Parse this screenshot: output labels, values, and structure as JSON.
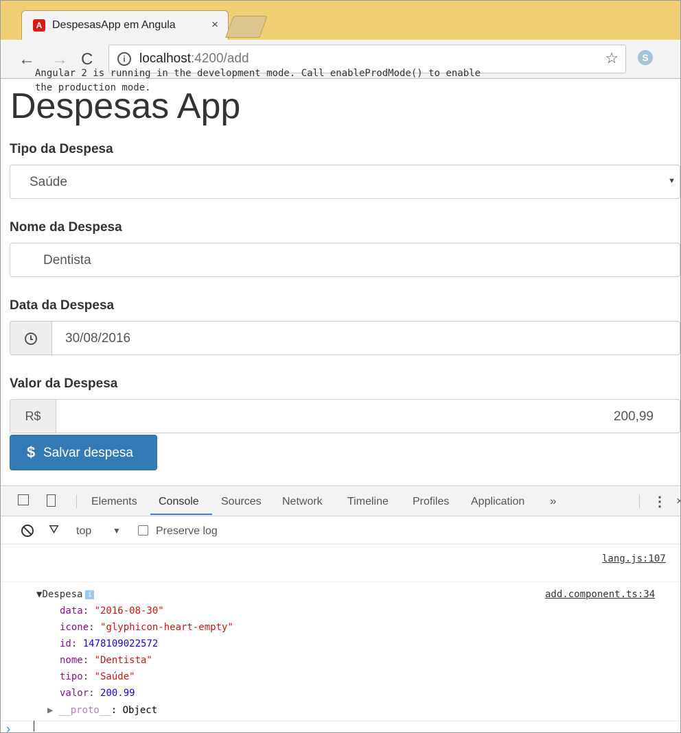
{
  "browser": {
    "tab_title": "DespesasApp em Angula",
    "tab_close": "×",
    "url_host": "localhost",
    "url_rest": ":4200/add",
    "star": "☆"
  },
  "page": {
    "title": "Despesas App",
    "tipo_label": "Tipo da Despesa",
    "tipo_value": "Saúde",
    "nome_label": "Nome da Despesa",
    "nome_value": "Dentista",
    "data_label": "Data da Despesa",
    "data_value": "30/08/2016",
    "valor_label": "Valor da Despesa",
    "currency": "R$",
    "valor_value": "200,99",
    "save_icon": "$",
    "save_label": "Salvar despesa"
  },
  "devtools": {
    "tabs": [
      "Elements",
      "Console",
      "Sources",
      "Network",
      "Timeline",
      "Profiles",
      "Application"
    ],
    "more": "»",
    "context": "top",
    "preserve_log": "Preserve log",
    "message1_line1": "Angular 2 is running in the development mode. Call enableProdMode() to enable",
    "message1_line2": "the production mode.",
    "message1_src": "lang.js:107",
    "object_name": "Despesa",
    "object_src": "add.component.ts:34",
    "props": [
      {
        "key": "data",
        "value": "\"2016-08-30\"",
        "kind": "string"
      },
      {
        "key": "icone",
        "value": "\"glyphicon-heart-empty\"",
        "kind": "string"
      },
      {
        "key": "id",
        "value": "1478109022572",
        "kind": "number"
      },
      {
        "key": "nome",
        "value": "\"Dentista\"",
        "kind": "string"
      },
      {
        "key": "tipo",
        "value": "\"Saúde\"",
        "kind": "string"
      },
      {
        "key": "valor",
        "value": "200.99",
        "kind": "number"
      }
    ],
    "proto_key": "__proto__",
    "proto_value": "Object"
  },
  "colors": {
    "tabstrip": "#f1cf74",
    "primary_button": "#337ab7",
    "devtools_accent": "#3879d9",
    "string_value": "#c41a16",
    "number_value": "#1c00cf",
    "property_key": "#881391"
  }
}
